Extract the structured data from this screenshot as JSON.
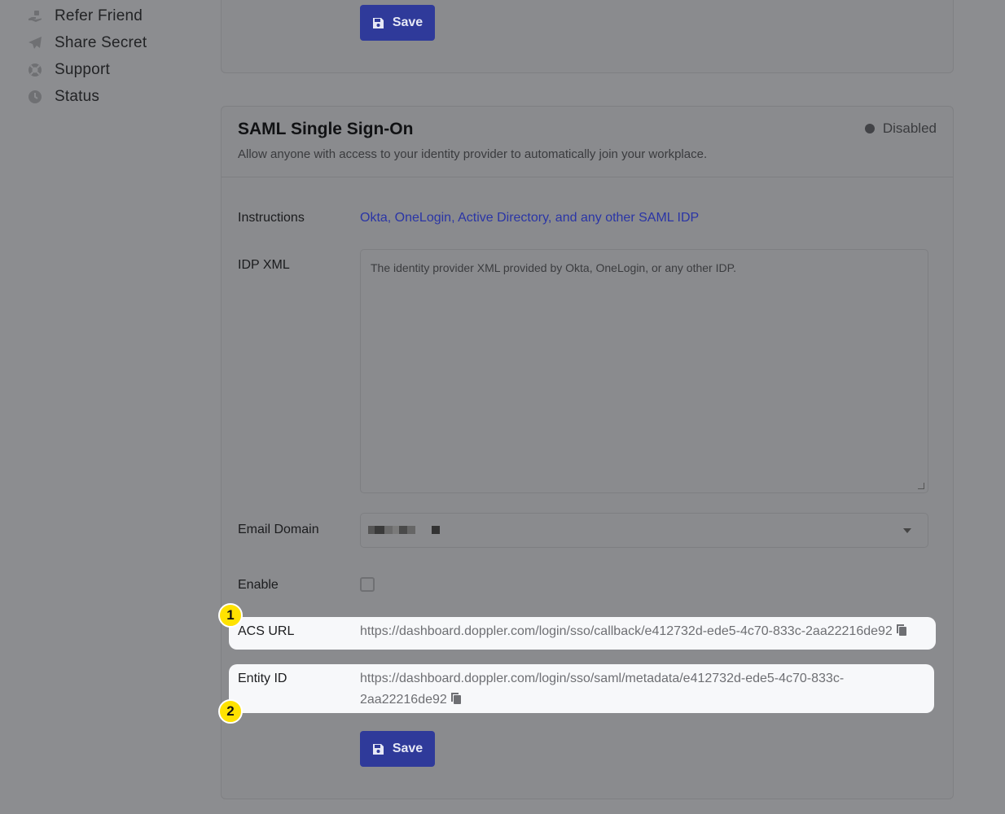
{
  "sidebar": {
    "items": [
      {
        "label": "Refer Friend",
        "icon": "hand-gift-icon"
      },
      {
        "label": "Share Secret",
        "icon": "paper-plane-icon"
      },
      {
        "label": "Support",
        "icon": "lifebuoy-icon"
      },
      {
        "label": "Status",
        "icon": "clock-icon"
      }
    ]
  },
  "top_card": {
    "save_label": "Save"
  },
  "saml": {
    "title": "SAML Single Sign-On",
    "subtitle": "Allow anyone with access to your identity provider to automatically join your workplace.",
    "status": "Disabled",
    "instructions_label": "Instructions",
    "instructions_link": "Okta, OneLogin, Active Directory, and any other SAML IDP",
    "idp_xml_label": "IDP XML",
    "idp_xml_placeholder": "The identity provider XML provided by Okta, OneLogin, or any other IDP.",
    "email_domain_label": "Email Domain",
    "enable_label": "Enable",
    "enable_checked": false,
    "acs_url_label": "ACS URL",
    "acs_url_value": "https://dashboard.doppler.com/login/sso/callback/e412732d-ede5-4c70-833c-2aa22216de92",
    "entity_id_label": "Entity ID",
    "entity_id_line1": "https://dashboard.doppler.com/login/sso/saml/metadata/e412732d-ede5-4c70-833c-",
    "entity_id_line2": "2aa22216de92",
    "save_label": "Save"
  },
  "badges": [
    "1",
    "2"
  ],
  "colors": {
    "primary": "#3e4bd1",
    "highlight": "#ffe200",
    "link": "#2a35a6"
  }
}
